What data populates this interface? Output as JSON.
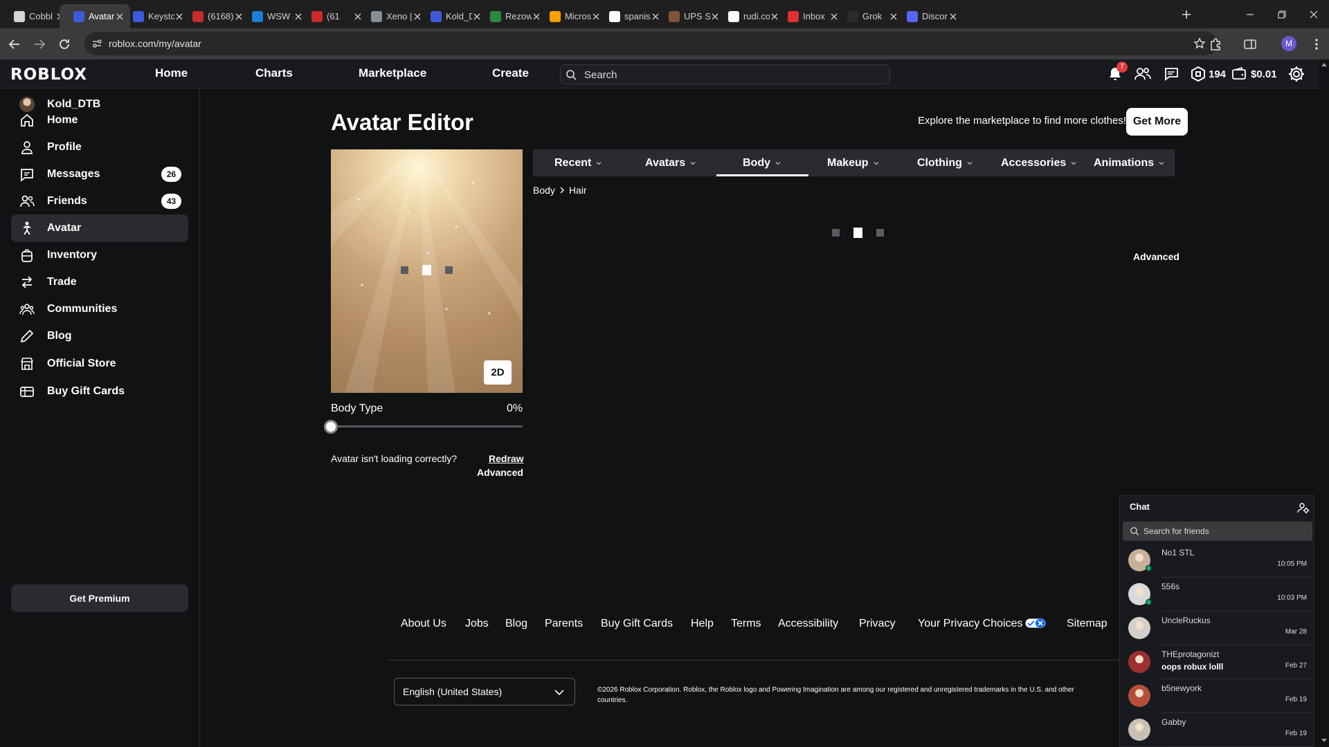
{
  "browser": {
    "tabs": [
      {
        "label": "Cobbl",
        "color": "#d6d6d6"
      },
      {
        "label": "Avatar",
        "color": "#3b5bdb",
        "active": true
      },
      {
        "label": "Keysto",
        "color": "#3b5bdb"
      },
      {
        "label": "(6168)",
        "color": "#c92a2a"
      },
      {
        "label": "WSW -",
        "color": "#1c7ed6"
      },
      {
        "label": "(61",
        "color": "#c92a2a"
      },
      {
        "label": "Xeno |",
        "color": "#868e96"
      },
      {
        "label": "Kold_D",
        "color": "#3b5bdb"
      },
      {
        "label": "Rezow",
        "color": "#2b8a3e"
      },
      {
        "label": "Micros",
        "color": "#f59f00"
      },
      {
        "label": "spanis",
        "color": "#ffffff"
      },
      {
        "label": "UPS S",
        "color": "#7f5539"
      },
      {
        "label": "rudi.co",
        "color": "#ffffff"
      },
      {
        "label": "Inbox",
        "color": "#e03131"
      },
      {
        "label": "Grok",
        "color": "#2b2b2b"
      },
      {
        "label": "Discor",
        "color": "#5865f2"
      }
    ],
    "url": "roblox.com/my/avatar",
    "profile_initial": "M"
  },
  "header": {
    "logo": "ROBLOX",
    "nav": [
      "Home",
      "Charts",
      "Marketplace",
      "Create"
    ],
    "search_placeholder": "Search",
    "notification_count": "7",
    "robux": "194",
    "balance": "$0.01"
  },
  "sidebar": {
    "username": "Kold_DTB",
    "items": [
      {
        "label": "Home",
        "icon": "home-icon"
      },
      {
        "label": "Profile",
        "icon": "profile-icon"
      },
      {
        "label": "Messages",
        "icon": "messages-icon",
        "badge": "26"
      },
      {
        "label": "Friends",
        "icon": "friends-icon",
        "badge": "43"
      },
      {
        "label": "Avatar",
        "icon": "avatar-icon",
        "active": true
      },
      {
        "label": "Inventory",
        "icon": "inventory-icon"
      },
      {
        "label": "Trade",
        "icon": "trade-icon"
      },
      {
        "label": "Communities",
        "icon": "communities-icon"
      },
      {
        "label": "Blog",
        "icon": "blog-icon"
      },
      {
        "label": "Official Store",
        "icon": "store-icon"
      },
      {
        "label": "Buy Gift Cards",
        "icon": "gift-card-icon"
      }
    ],
    "premium_label": "Get Premium"
  },
  "editor": {
    "title": "Avatar Editor",
    "explore_text": "Explore the marketplace to find more clothes!",
    "get_more": "Get More",
    "view_toggle": "2D",
    "body_type_label": "Body Type",
    "body_type_value": "0%",
    "body_type_fraction": 0,
    "not_loading_text": "Avatar isn't loading correctly?",
    "redraw": "Redraw",
    "advanced": "Advanced",
    "tabs": [
      "Recent",
      "Avatars",
      "Body",
      "Makeup",
      "Clothing",
      "Accessories",
      "Animations"
    ],
    "active_tab": "Body",
    "breadcrumb": [
      "Body",
      "Hair"
    ],
    "advanced_right": "Advanced"
  },
  "footer": {
    "links": [
      "About Us",
      "Jobs",
      "Blog",
      "Parents",
      "Buy Gift Cards",
      "Help",
      "Terms",
      "Accessibility",
      "Privacy",
      "Your Privacy Choices",
      "Sitemap"
    ],
    "language": "English (United States)",
    "copyright": "©2026 Roblox Corporation. Roblox, the Roblox logo and Powering Imagination are among our registered and unregistered trademarks in the U.S. and other countries."
  },
  "chat": {
    "title": "Chat",
    "search_placeholder": "Search for friends",
    "conversations": [
      {
        "name": "No1 STL",
        "message": "",
        "time": "10:05 PM",
        "online": true,
        "avatar_color": "#c7b299"
      },
      {
        "name": "556s",
        "message": "",
        "time": "10:03 PM",
        "online": true,
        "avatar_color": "#d9d9d9"
      },
      {
        "name": "UncleRuckus",
        "message": "",
        "time": "Mar 28",
        "online": false,
        "avatar_color": "#d4cfc9"
      },
      {
        "name": "THEprotagonizt",
        "message": "oops robux lolll",
        "time": "Feb 27",
        "online": false,
        "avatar_color": "#9c2f2f"
      },
      {
        "name": "b5newyork",
        "message": "",
        "time": "Feb 19",
        "online": false,
        "avatar_color": "#b54f3a"
      },
      {
        "name": "Gabby",
        "message": "",
        "time": "Feb 19",
        "online": false,
        "avatar_color": "#c9c0b4"
      }
    ]
  }
}
